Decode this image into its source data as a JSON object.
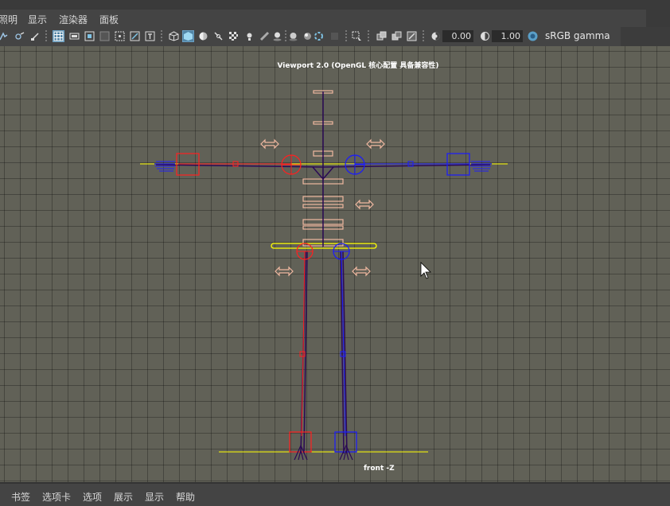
{
  "menu": {
    "items": [
      "照明",
      "显示",
      "渲染器",
      "面板"
    ]
  },
  "toolbar": {
    "exposure": "0.00",
    "gamma": "1.00",
    "color_space": "sRGB gamma"
  },
  "viewport": {
    "title": "Viewport 2.0 (OpenGL 核心配置 具备兼容性)",
    "camera_label": "front -Z"
  },
  "bottom_tabs": {
    "items": [
      "书签",
      "选项卡",
      "选项",
      "展示",
      "显示",
      "帮助"
    ]
  },
  "colors": {
    "viewport_bg": "#616157",
    "left_side": "#ff2020",
    "right_side": "#1a1aff",
    "control": "#f0b8a0",
    "ground": "#ffff00",
    "joint": "#3a0a5a"
  }
}
